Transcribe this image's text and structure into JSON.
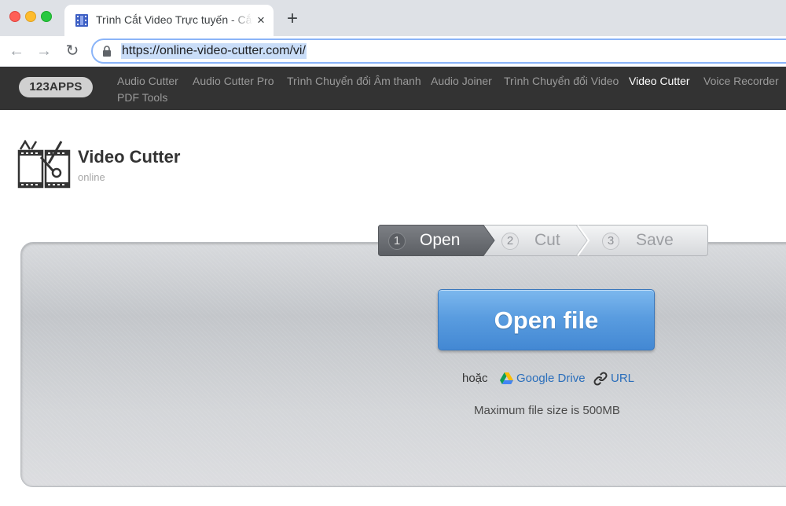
{
  "browser": {
    "tab_title": "Trình Cắt Video Trực tuyến - Cắt Video",
    "tab_close": "×",
    "new_tab": "+",
    "nav_back": "←",
    "nav_forward": "→",
    "nav_reload": "↻",
    "url": "https://online-video-cutter.com/vi/"
  },
  "site_nav": {
    "logo": "123APPS",
    "links": [
      "Audio Cutter",
      "Audio Cutter Pro",
      "Trình Chuyển đổi Âm thanh",
      "Audio Joiner",
      "Trình Chuyển đổi Video",
      "Video Cutter",
      "Voice Recorder",
      "PDF Tools"
    ],
    "active_link": "Video Cutter"
  },
  "header": {
    "title": "Video Cutter",
    "subtitle": "online"
  },
  "steps": [
    {
      "number": "1",
      "label": "Open",
      "active": true
    },
    {
      "number": "2",
      "label": "Cut",
      "active": false
    },
    {
      "number": "3",
      "label": "Save",
      "active": false
    }
  ],
  "main": {
    "open_button": "Open file",
    "or_text": "hoặc",
    "google_drive": "Google Drive",
    "url_link": "URL",
    "max_size": "Maximum file size is 500MB"
  },
  "colors": {
    "site_nav_bg": "#333333",
    "primary_button": "#4a8fd8",
    "link": "#2a6ebb",
    "active_step": "#6b6e73"
  }
}
